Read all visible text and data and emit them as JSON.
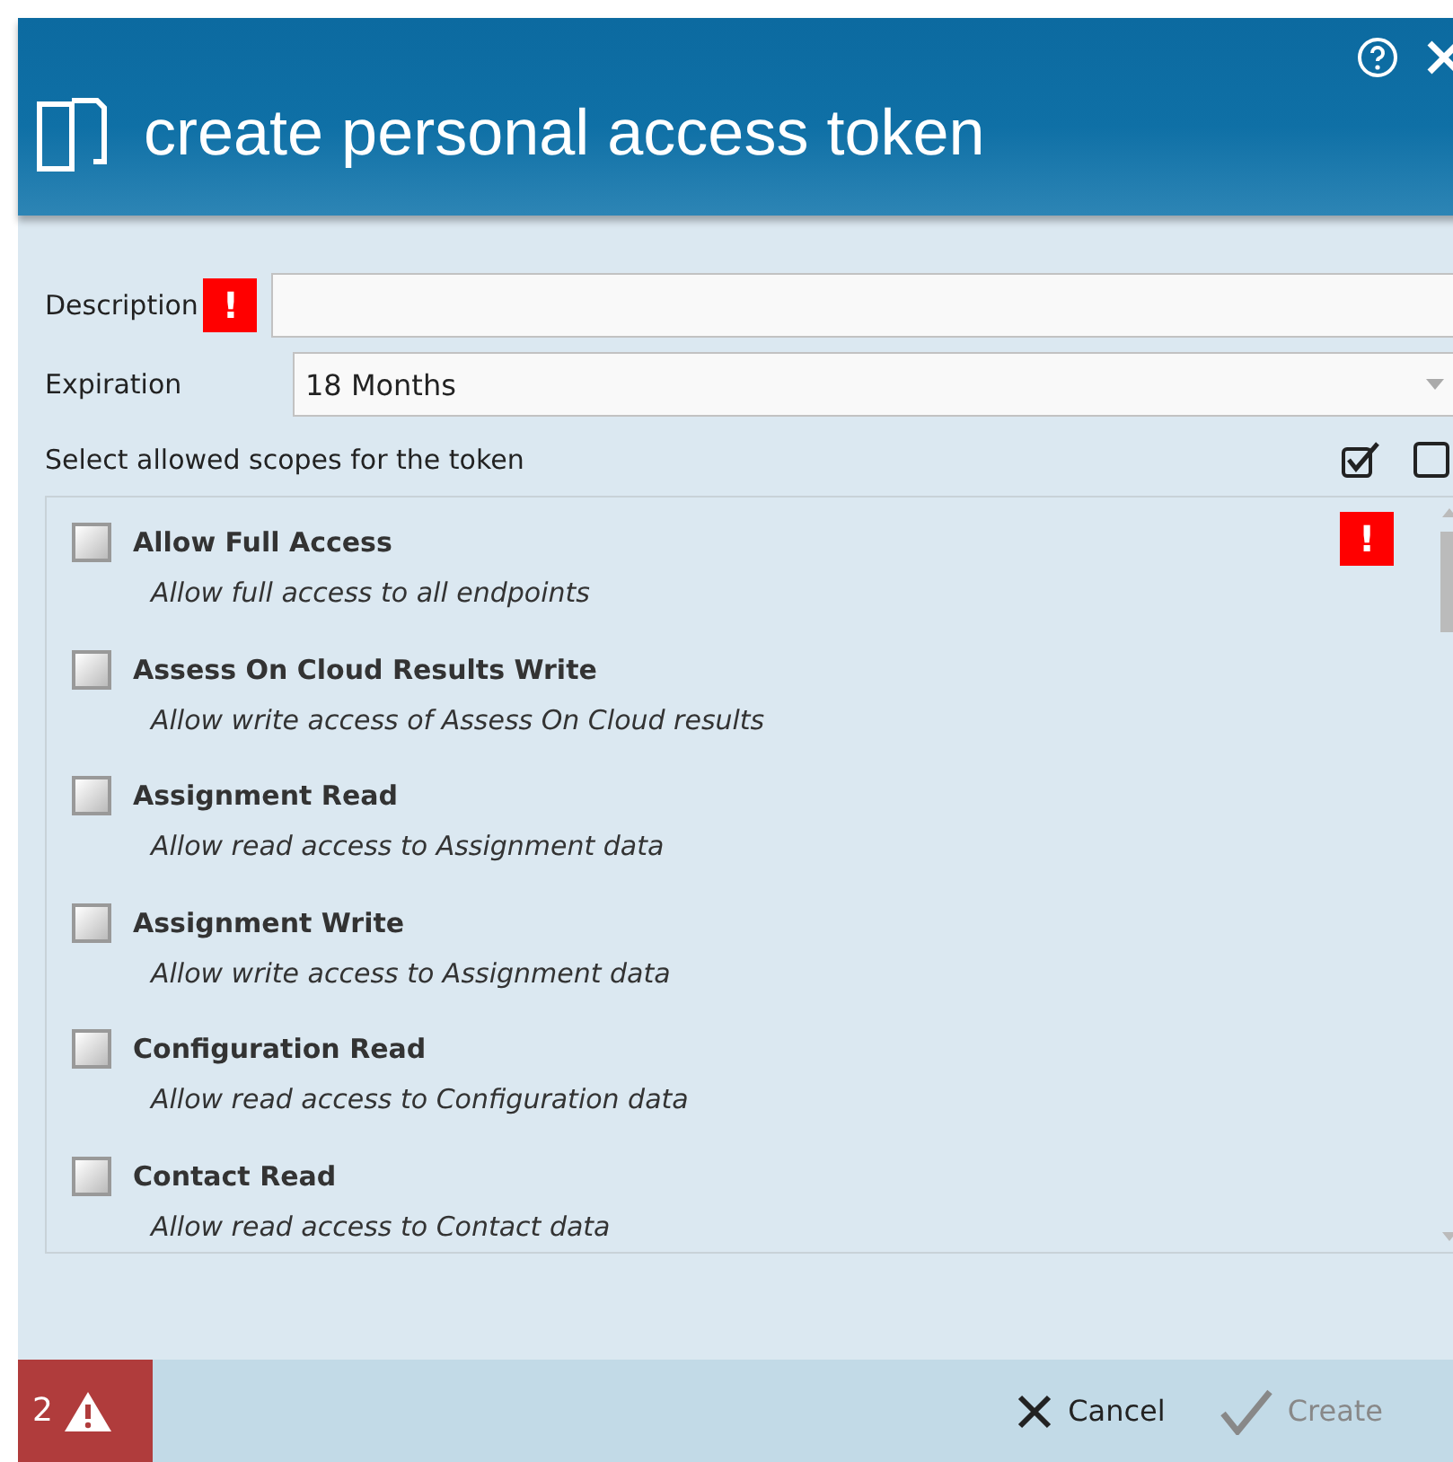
{
  "window": {
    "title": "create personal access token"
  },
  "form": {
    "description": {
      "label": "Description",
      "error_mark": "!"
    },
    "expiration": {
      "label": "Expiration",
      "value": "18 Months"
    }
  },
  "scopes": {
    "label": "Select allowed scopes for the token",
    "error_mark": "!",
    "items": [
      {
        "name": "Allow Full Access",
        "description": "Allow full access to all endpoints",
        "checked": false
      },
      {
        "name": "Assess On Cloud Results Write",
        "description": "Allow write access of Assess On Cloud results",
        "checked": false
      },
      {
        "name": "Assignment Read",
        "description": "Allow read access to Assignment data",
        "checked": false
      },
      {
        "name": "Assignment Write",
        "description": "Allow write access to Assignment data",
        "checked": false
      },
      {
        "name": "Configuration Read",
        "description": "Allow read access to Configuration data",
        "checked": false
      },
      {
        "name": "Contact Read",
        "description": "Allow read access to Contact data",
        "checked": false
      }
    ]
  },
  "footer": {
    "error_count": "2",
    "buttons": [
      {
        "label": "Cancel",
        "kind": "cancel",
        "disabled": false
      },
      {
        "label": "Create",
        "kind": "create",
        "disabled": true
      }
    ]
  }
}
